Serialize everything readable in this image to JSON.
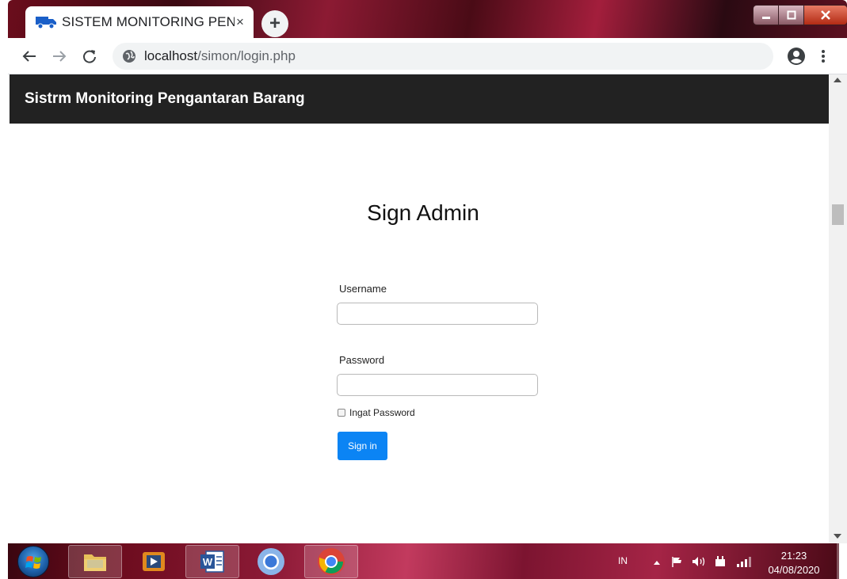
{
  "browser": {
    "tab": {
      "title": "SISTEM MONITORING PEN",
      "close_glyph": "×",
      "favicon": "truck-icon"
    },
    "new_tab_glyph": "+",
    "address": {
      "host": "localhost",
      "path": "/simon/login.php"
    }
  },
  "navbar": {
    "brand": "Sistrm Monitoring Pengantaran Barang"
  },
  "login": {
    "heading": "Sign Admin",
    "username_label": "Username",
    "username_value": "",
    "password_label": "Password",
    "password_value": "",
    "remember_label": "Ingat Password",
    "remember_checked": false,
    "submit_label": "Sign in"
  },
  "taskbar": {
    "apps": [
      "windows-explorer",
      "media-player",
      "microsoft-word",
      "chromium",
      "google-chrome"
    ],
    "tray": {
      "language": "IN",
      "time": "21:23",
      "date": "04/08/2020"
    }
  },
  "colors": {
    "navbar_bg": "#222222",
    "primary_button": "#0b84f4",
    "favicon_blue": "#1a5fc8"
  }
}
